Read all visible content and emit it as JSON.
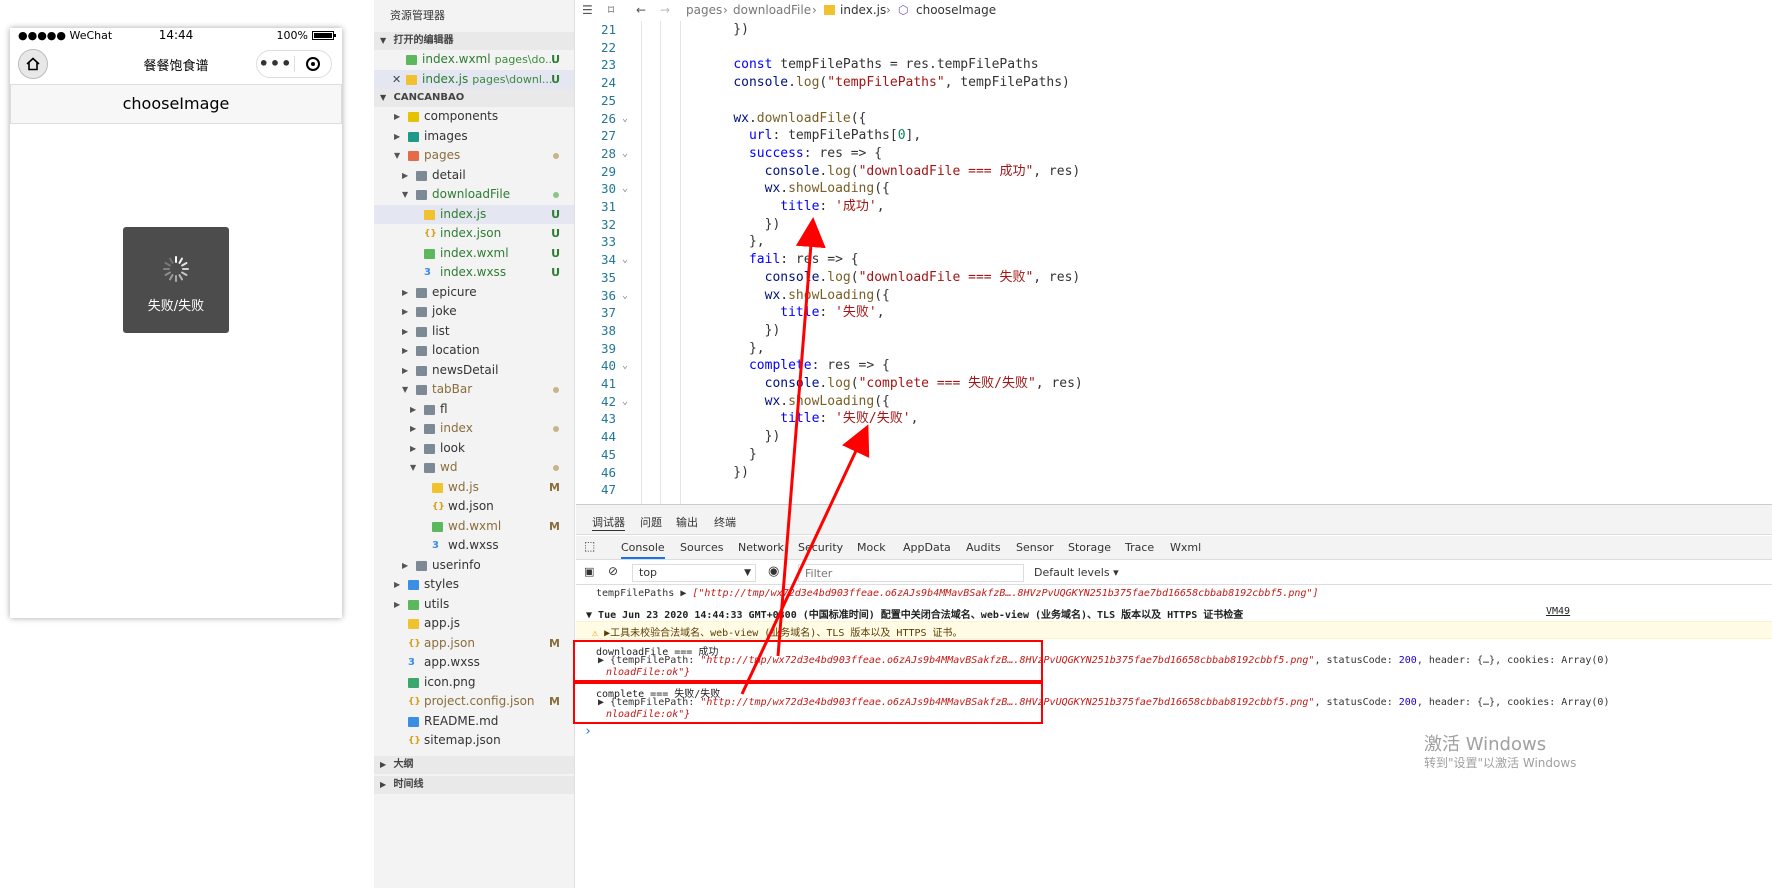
{
  "phone": {
    "carrier": "●●●●● WeChat",
    "time": "14:44",
    "battery": "100%",
    "nav_title": "餐餐饱食谱",
    "page_header": "chooseImage",
    "toast_text": "失败/失败"
  },
  "explorer": {
    "title": "资源管理器",
    "open_editors_label": "打开的编辑器",
    "open_editors": [
      {
        "name": "index.wxml",
        "path": "pages\\do...",
        "badge": "U"
      },
      {
        "name": "index.js",
        "path": "pages\\downl...",
        "badge": "U"
      }
    ],
    "project_label": "CANCANBAO",
    "tree": [
      {
        "name": "components"
      },
      {
        "name": "images"
      },
      {
        "name": "pages"
      },
      {
        "name": "detail"
      },
      {
        "name": "downloadFile"
      },
      {
        "name": "index.js",
        "badge": "U"
      },
      {
        "name": "index.json",
        "badge": "U"
      },
      {
        "name": "index.wxml",
        "badge": "U"
      },
      {
        "name": "index.wxss",
        "badge": "U"
      },
      {
        "name": "epicure"
      },
      {
        "name": "joke"
      },
      {
        "name": "list"
      },
      {
        "name": "location"
      },
      {
        "name": "newsDetail"
      },
      {
        "name": "tabBar"
      },
      {
        "name": "fl"
      },
      {
        "name": "index"
      },
      {
        "name": "look"
      },
      {
        "name": "wd"
      },
      {
        "name": "wd.js",
        "badge": "M"
      },
      {
        "name": "wd.json"
      },
      {
        "name": "wd.wxml",
        "badge": "M"
      },
      {
        "name": "wd.wxss"
      },
      {
        "name": "userinfo"
      },
      {
        "name": "styles"
      },
      {
        "name": "utils"
      },
      {
        "name": "app.js"
      },
      {
        "name": "app.json",
        "badge": "M"
      },
      {
        "name": "app.wxss"
      },
      {
        "name": "icon.png"
      },
      {
        "name": "project.config.json",
        "badge": "M"
      },
      {
        "name": "README.md"
      },
      {
        "name": "sitemap.json"
      }
    ],
    "outline_label": "大纲",
    "timeline_label": "时间线"
  },
  "editor": {
    "breadcrumb": [
      "pages",
      "downloadFile",
      "index.js",
      "chooseImage"
    ],
    "lines": [
      {
        "n": "21",
        "t": "    })"
      },
      {
        "n": "22",
        "t": ""
      },
      {
        "n": "23",
        "t": "    const tempFilePaths = res.tempFilePaths"
      },
      {
        "n": "24",
        "t": "    console.log(\"tempFilePaths\", tempFilePaths)"
      },
      {
        "n": "25",
        "t": ""
      },
      {
        "n": "26",
        "t": "    wx.downloadFile({"
      },
      {
        "n": "27",
        "t": "      url: tempFilePaths[0],"
      },
      {
        "n": "28",
        "t": "      success: res => {"
      },
      {
        "n": "29",
        "t": "        console.log(\"downloadFile === 成功\", res)"
      },
      {
        "n": "30",
        "t": "        wx.showLoading({"
      },
      {
        "n": "31",
        "t": "          title: '成功',"
      },
      {
        "n": "32",
        "t": "        })"
      },
      {
        "n": "33",
        "t": "      },"
      },
      {
        "n": "34",
        "t": "      fail: res => {"
      },
      {
        "n": "35",
        "t": "        console.log(\"downloadFile === 失败\", res)"
      },
      {
        "n": "36",
        "t": "        wx.showLoading({"
      },
      {
        "n": "37",
        "t": "          title: '失败',"
      },
      {
        "n": "38",
        "t": "        })"
      },
      {
        "n": "39",
        "t": "      },"
      },
      {
        "n": "40",
        "t": "      complete: res => {"
      },
      {
        "n": "41",
        "t": "        console.log(\"complete === 失败/失败\", res)"
      },
      {
        "n": "42",
        "t": "        wx.showLoading({"
      },
      {
        "n": "43",
        "t": "          title: '失败/失败',"
      },
      {
        "n": "44",
        "t": "        })"
      },
      {
        "n": "45",
        "t": "      }"
      },
      {
        "n": "46",
        "t": "    })"
      },
      {
        "n": "47",
        "t": ""
      }
    ]
  },
  "debug": {
    "panel_tabs": [
      "调试器",
      "问题",
      "输出",
      "终端"
    ],
    "devtools_tabs": [
      "Console",
      "Sources",
      "Network",
      "Security",
      "Mock",
      "AppData",
      "Audits",
      "Sensor",
      "Storage",
      "Trace",
      "Wxml"
    ],
    "context": "top",
    "filter_placeholder": "Filter",
    "levels": "Default levels",
    "logs": {
      "paths_label": "tempFilePaths",
      "paths_value": "[\"http://tmp/wx72d3e4bd903ffeae.o6zAJs9b4MMavBSakfzB….8HVzPvUQGKYN251b375fae7bd16658cbbab8192cbbf5.png\"]",
      "date_line": "Tue Jun 23 2020 14:44:33 GMT+0800 (中国标准时间) 配置中关闭合法域名、web-view (业务域名)、TLS 版本以及 HTTPS 证书检查",
      "vm_ref": "VM49",
      "warn_line": "工具未校验合法域名、web-view (业务域名)、TLS 版本以及 HTTPS 证书。",
      "success_label": "downloadFile === 成功",
      "object_prefix": "{tempFilePath: ",
      "object_path": "\"http://tmp/wx72d3e4bd903ffeae.o6zAJs9b4MMavBSakfzB….8HVzPvUQGKYN251b375fae7bd16658cbbab8192cbbf5.png\"",
      "object_mid": ", statusCode: ",
      "status_code": "200",
      "object_tail": ", header: {…}, cookies: Array(0)",
      "errmsg": "nloadFile:ok\"}",
      "complete_label": "complete === 失败/失败"
    },
    "prompt": "›"
  },
  "watermark": {
    "line1": "激活 Windows",
    "line2": "转到\"设置\"以激活 Windows"
  },
  "colors": {
    "accent": "#1a73e8",
    "annotation": "#ff0000",
    "toast_bg": "#4c4c4c"
  }
}
